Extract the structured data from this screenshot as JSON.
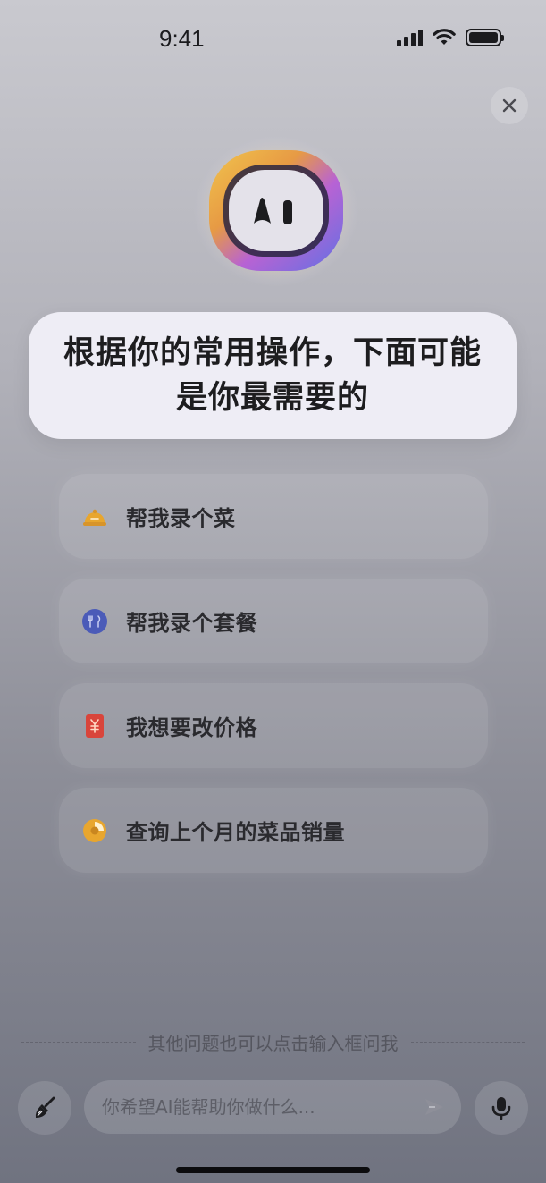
{
  "status_bar": {
    "time": "9:41"
  },
  "header": {
    "close_icon": "close-icon"
  },
  "assistant": {
    "avatar_label": "AI"
  },
  "bubble": {
    "line1": "根据你的常用操作，下面可能",
    "line2": "是你最需要的"
  },
  "suggestions": [
    {
      "label": "帮我录个菜",
      "icon": "dish-cloche-icon",
      "color": "#e8a62e"
    },
    {
      "label": "帮我录个套餐",
      "icon": "combo-meal-icon",
      "color": "#4b5bb8"
    },
    {
      "label": "我想要改价格",
      "icon": "price-tag-icon",
      "color": "#d9453b"
    },
    {
      "label": "查询上个月的菜品销量",
      "icon": "pie-chart-icon",
      "color": "#e8a62e"
    }
  ],
  "footer": {
    "hint": "其他问题也可以点击输入框问我",
    "input_placeholder": "你希望AI能帮助你做什么..."
  },
  "colors": {
    "bubble_bg": "#eeedf5",
    "accent_orange": "#e8a62e",
    "accent_blue": "#4b5bb8",
    "accent_red": "#d9453b"
  }
}
